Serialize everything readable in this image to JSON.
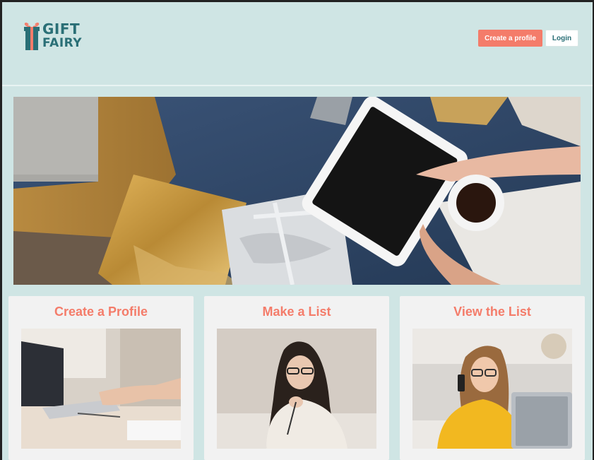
{
  "brand": {
    "line1": "GIFT",
    "line2": "FAIRY"
  },
  "nav": {
    "create_label": "Create a profile",
    "login_label": "Login"
  },
  "cards": [
    {
      "title": "Create a Profile"
    },
    {
      "title": "Make a List"
    },
    {
      "title": "View the List"
    }
  ],
  "colors": {
    "accent": "#f47c6a",
    "brand": "#2a6f76",
    "background": "#cfe5e4",
    "card": "#f2f2f2"
  }
}
